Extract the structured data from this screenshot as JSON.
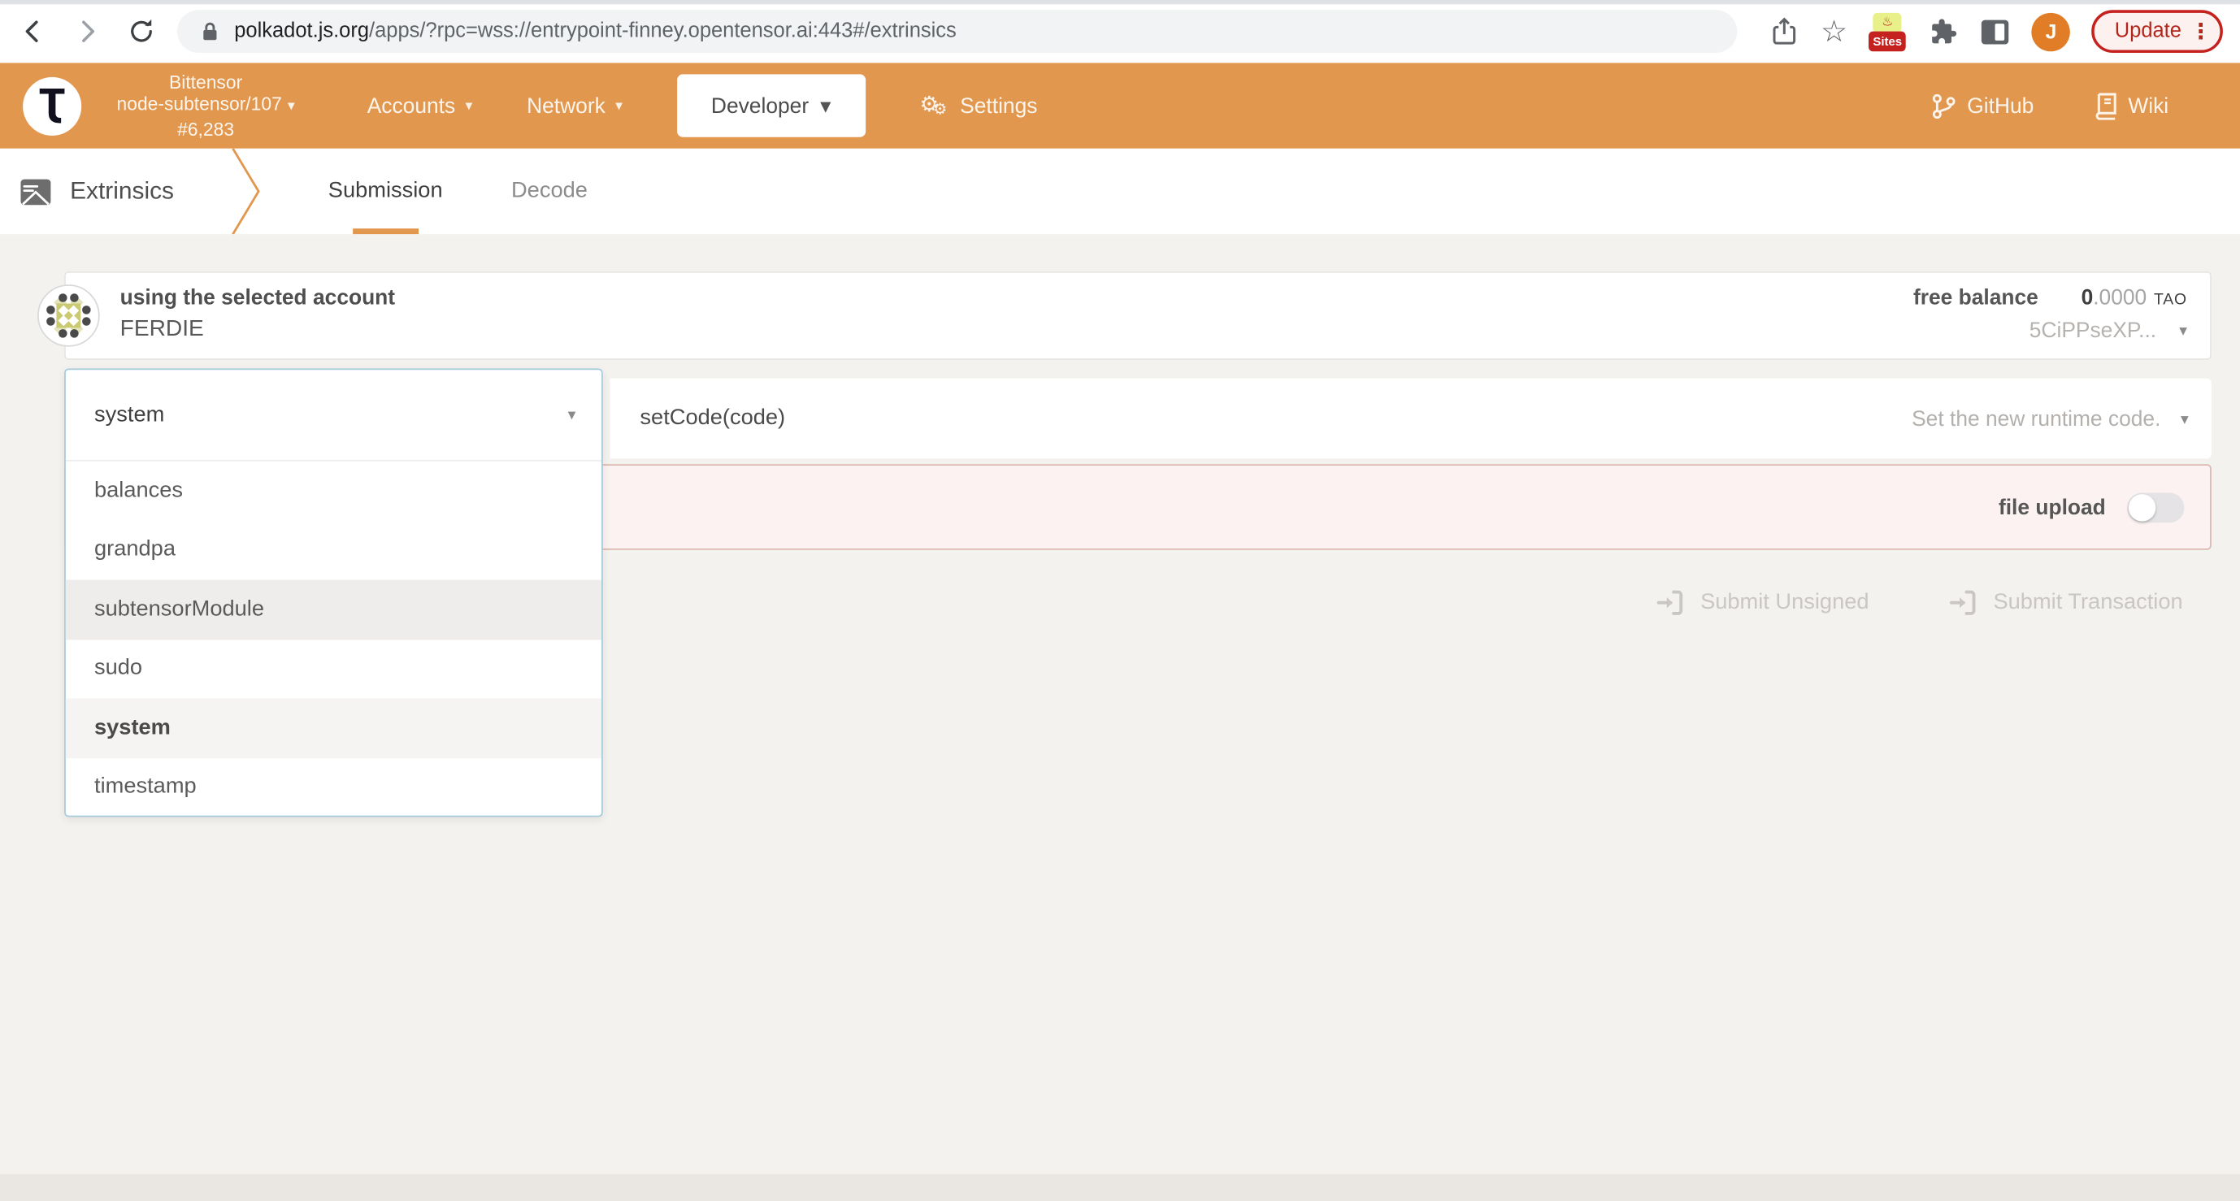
{
  "browser": {
    "url_host": "polkadot.js.org",
    "url_rest": "/apps/?rpc=wss://entrypoint-finney.opentensor.ai:443#/extrinsics",
    "sites_badge": "Sites",
    "avatar_initial": "J",
    "update_label": "Update",
    "dots_vertical": "⋮",
    "star_glyph": "☆"
  },
  "header": {
    "logo_glyph": "Ʈ",
    "chain": {
      "name": "Bittensor",
      "node": "node-subtensor/107",
      "block": "#6,283"
    },
    "nav": [
      {
        "label": "Accounts"
      },
      {
        "label": "Network"
      },
      {
        "label": "Developer",
        "active": true
      },
      {
        "label": "Settings"
      }
    ],
    "gear_glyph": "⚙",
    "links": [
      {
        "label": "GitHub"
      },
      {
        "label": "Wiki"
      }
    ],
    "accent_color": "#e2974f"
  },
  "tabbar": {
    "section": "Extrinsics",
    "tabs": [
      {
        "label": "Submission",
        "active": true
      },
      {
        "label": "Decode"
      }
    ]
  },
  "account": {
    "label": "using the selected account",
    "name": "FERDIE",
    "balance_label": "free balance",
    "balance_int": "0",
    "balance_frac": ".0000",
    "balance_unit": "TAO",
    "address_short": "5CiPPseXP..."
  },
  "extrinsic": {
    "pallet_selected": "system",
    "method": "setCode(code)",
    "method_hint": "Set the new runtime code.",
    "file_upload_label": "file upload",
    "file_upload_on": false
  },
  "dropdown": {
    "selected": "system",
    "options": [
      {
        "label": "balances"
      },
      {
        "label": "grandpa"
      },
      {
        "label": "subtensorModule",
        "hover": true
      },
      {
        "label": "sudo"
      },
      {
        "label": "system",
        "selected": true
      },
      {
        "label": "timestamp"
      }
    ]
  },
  "actions": [
    {
      "label": "Submit Unsigned",
      "enabled": false
    },
    {
      "label": "Submit Transaction",
      "enabled": false
    }
  ],
  "glyphs": {
    "caret_down": "▾"
  }
}
